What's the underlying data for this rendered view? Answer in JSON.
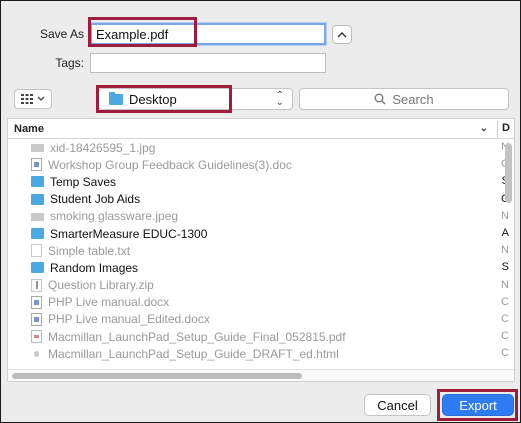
{
  "form": {
    "save_as_label": "Save As",
    "filename": "Example.pdf",
    "tags_label": "Tags:",
    "tags_value": ""
  },
  "location": {
    "folder": "Desktop",
    "search_placeholder": "Search"
  },
  "list": {
    "column_name": "Name",
    "column_d": "D",
    "rows": [
      {
        "name": "xid-18426595_1.jpg",
        "icon": "image-file-icon",
        "enabled": false,
        "end": "N"
      },
      {
        "name": "Workshop Group Feedback Guidelines(3).doc",
        "icon": "word-doc-icon",
        "enabled": false,
        "end": "C"
      },
      {
        "name": "Temp Saves",
        "icon": "folder-icon",
        "enabled": true,
        "end": "S"
      },
      {
        "name": "Student Job Aids",
        "icon": "folder-icon",
        "enabled": true,
        "end": "C"
      },
      {
        "name": "smoking glassware.jpeg",
        "icon": "image-file-icon",
        "enabled": false,
        "end": "N"
      },
      {
        "name": "SmarterMeasure EDUC-1300",
        "icon": "folder-icon",
        "enabled": true,
        "end": "A"
      },
      {
        "name": "Simple table.txt",
        "icon": "text-file-icon",
        "enabled": false,
        "end": "N"
      },
      {
        "name": "Random Images",
        "icon": "folder-icon",
        "enabled": true,
        "end": "S"
      },
      {
        "name": "Question Library.zip",
        "icon": "zip-file-icon",
        "enabled": false,
        "end": "N"
      },
      {
        "name": "PHP Live manual.docx",
        "icon": "word-doc-icon",
        "enabled": false,
        "end": "C"
      },
      {
        "name": "PHP Live manual_Edited.docx",
        "icon": "word-doc-icon",
        "enabled": false,
        "end": "C"
      },
      {
        "name": "Macmillan_LaunchPad_Setup_Guide_Final_052815.pdf",
        "icon": "pdf-file-icon",
        "enabled": false,
        "end": "C"
      },
      {
        "name": "Macmillan_LaunchPad_Setup_Guide_DRAFT_ed.html",
        "icon": "html-file-icon",
        "enabled": false,
        "end": "C"
      }
    ]
  },
  "buttons": {
    "cancel": "Cancel",
    "export": "Export"
  },
  "colors": {
    "highlight": "#a01c3c",
    "primary": "#2d7cf6",
    "folder": "#4aa9e3"
  }
}
